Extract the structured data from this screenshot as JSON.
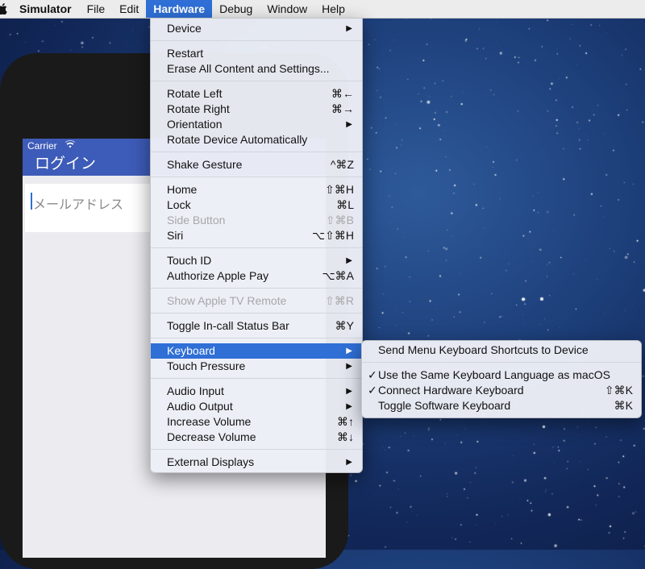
{
  "menubar": {
    "apple_icon": "apple-logo-icon",
    "items": [
      "Simulator",
      "File",
      "Edit",
      "Hardware",
      "Debug",
      "Window",
      "Help"
    ]
  },
  "device_screen": {
    "carrier": "Carrier",
    "wifi_icon": "wifi-icon",
    "title": "ログイン",
    "field_placeholder": "メールアドレス"
  },
  "hardware_menu": {
    "items": [
      {
        "label": "Device",
        "submenu": true
      },
      {
        "separator": true
      },
      {
        "label": "Restart"
      },
      {
        "label": "Erase All Content and Settings..."
      },
      {
        "separator": true
      },
      {
        "label": "Rotate Left",
        "shortcut": "⌘←"
      },
      {
        "label": "Rotate Right",
        "shortcut": "⌘→"
      },
      {
        "label": "Orientation",
        "submenu": true
      },
      {
        "label": "Rotate Device Automatically"
      },
      {
        "separator": true
      },
      {
        "label": "Shake Gesture",
        "shortcut": "^⌘Z"
      },
      {
        "separator": true
      },
      {
        "label": "Home",
        "shortcut": "⇧⌘H"
      },
      {
        "label": "Lock",
        "shortcut": "⌘L"
      },
      {
        "label": "Side Button",
        "shortcut": "⇧⌘B",
        "disabled": true
      },
      {
        "label": "Siri",
        "shortcut": "⌥⇧⌘H"
      },
      {
        "separator": true
      },
      {
        "label": "Touch ID",
        "submenu": true
      },
      {
        "label": "Authorize Apple Pay",
        "shortcut": "⌥⌘A"
      },
      {
        "separator": true
      },
      {
        "label": "Show Apple TV Remote",
        "shortcut": "⇧⌘R",
        "disabled": true
      },
      {
        "separator": true
      },
      {
        "label": "Toggle In-call Status Bar",
        "shortcut": "⌘Y"
      },
      {
        "separator": true
      },
      {
        "label": "Keyboard",
        "submenu": true,
        "highlighted": true
      },
      {
        "label": "Touch Pressure",
        "submenu": true
      },
      {
        "separator": true
      },
      {
        "label": "Audio Input",
        "submenu": true
      },
      {
        "label": "Audio Output",
        "submenu": true
      },
      {
        "label": "Increase Volume",
        "shortcut": "⌘↑"
      },
      {
        "label": "Decrease Volume",
        "shortcut": "⌘↓"
      },
      {
        "separator": true
      },
      {
        "label": "External Displays",
        "submenu": true
      }
    ]
  },
  "keyboard_submenu": {
    "items": [
      {
        "label": "Send Menu Keyboard Shortcuts to Device"
      },
      {
        "separator": true
      },
      {
        "label": "Use the Same Keyboard Language as macOS",
        "checked": true
      },
      {
        "label": "Connect Hardware Keyboard",
        "checked": true,
        "shortcut": "⇧⌘K"
      },
      {
        "label": "Toggle Software Keyboard",
        "shortcut": "⌘K"
      }
    ]
  },
  "colors": {
    "menu_highlight": "#2f6fd6",
    "nav_bar": "#3d5bb8",
    "desktop": "#1d3f7a"
  }
}
